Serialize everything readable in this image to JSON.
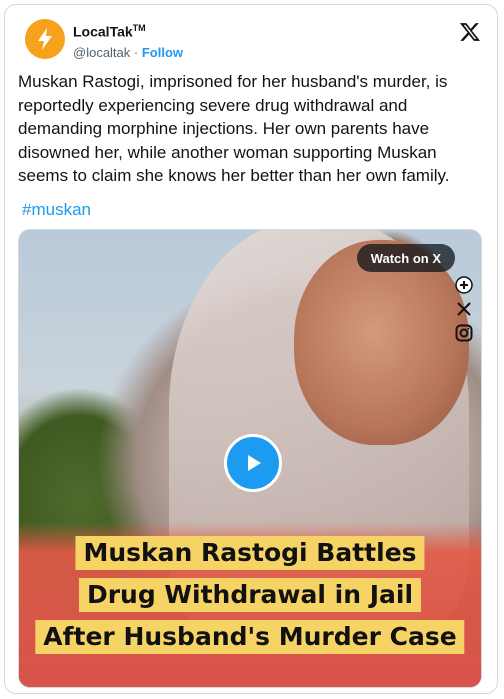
{
  "account": {
    "name": "LocalTak",
    "trademark": "TM",
    "handle": "@localtak",
    "separator": " · ",
    "follow_label": "Follow"
  },
  "tweet": {
    "text": "Muskan Rastogi, imprisoned for her husband's murder, is reportedly experiencing severe drug withdrawal and demanding morphine injections. Her own parents have disowned her, while another woman supporting Muskan seems to claim she knows her better than her own family.",
    "hashtag": "#muskan"
  },
  "media": {
    "watch_label": "Watch on X",
    "caption_lines": [
      "Muskan Rastogi Battles",
      "Drug Withdrawal in Jail",
      "After Husband's Murder Case"
    ],
    "side_icons": [
      "thread-icon",
      "x-logo-icon",
      "instagram-icon"
    ]
  },
  "colors": {
    "accent": "#1d9bf0",
    "avatar_bg": "#f6a21d",
    "caption_bg": "#f6d365",
    "caption_band": "#d9544a"
  }
}
